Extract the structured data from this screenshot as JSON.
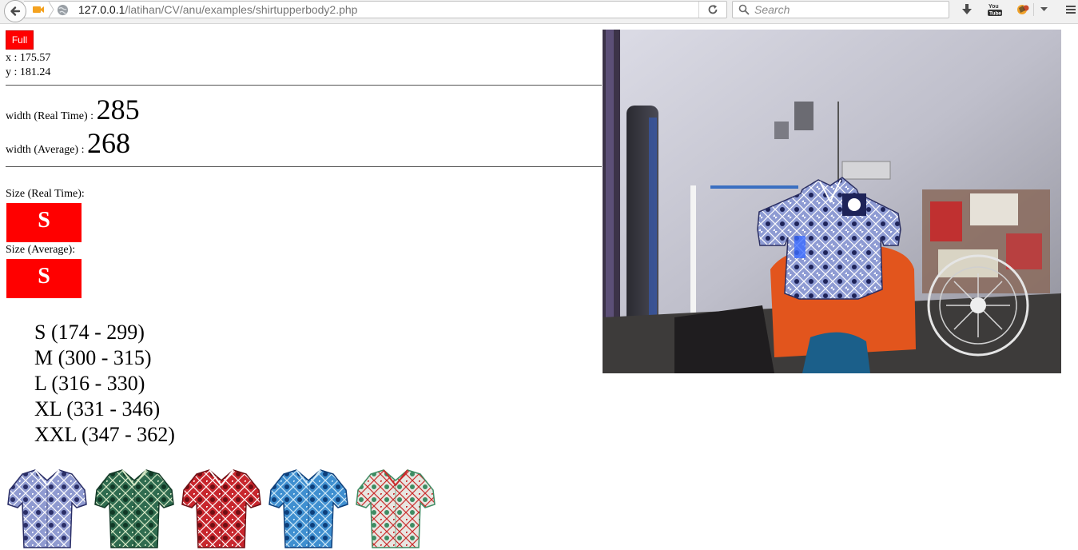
{
  "browser": {
    "url_host": "127.0.0.1",
    "url_path": "/latihan/CV/anu/examples/shirtupperbody2.php",
    "search_placeholder": "Search",
    "toolbar_icons": [
      "back-arrow-icon",
      "camera-icon",
      "globe-icon",
      "reload-icon",
      "search-icon",
      "download-icon",
      "youtube-icon",
      "extension-icon",
      "dropdown-icon",
      "menu-icon"
    ]
  },
  "controls": {
    "full_label": "Full"
  },
  "coords": {
    "x_line": "x : 175.57",
    "y_line": "y : 181.24"
  },
  "width": {
    "realtime_label": "width (Real Time) : ",
    "realtime_value": "285",
    "average_label": "width (Average) : ",
    "average_value": "268"
  },
  "size": {
    "realtime_label": "Size (Real Time):",
    "realtime_value": "S",
    "average_label": "Size (Average):",
    "average_value": "S"
  },
  "size_chart": [
    "S (174 - 299)",
    "M (300 - 315)",
    "L (316 - 330)",
    "XL (331 - 346)",
    "XXL (347 - 362)"
  ],
  "shirts": [
    {
      "name": "batik-blue-shirt",
      "base": "#8f9ad0",
      "accent": "#2a2e66",
      "detail": "#ffffff"
    },
    {
      "name": "batik-green-shirt",
      "base": "#2f6b4f",
      "accent": "#123826",
      "detail": "#d7e9c6"
    },
    {
      "name": "batik-red-shirt",
      "base": "#c8262d",
      "accent": "#6e0f14",
      "detail": "#ffffff"
    },
    {
      "name": "batik-lightblue-shirt",
      "base": "#3f8fd0",
      "accent": "#0e3f7a",
      "detail": "#cfe9f7"
    },
    {
      "name": "batik-white-floral-shirt",
      "base": "#e8e6e1",
      "accent": "#3e8c63",
      "detail": "#c92a2a"
    }
  ],
  "colors": {
    "size_badge": "#ff0000",
    "button": "#ff0000",
    "url_text": "#777777"
  }
}
